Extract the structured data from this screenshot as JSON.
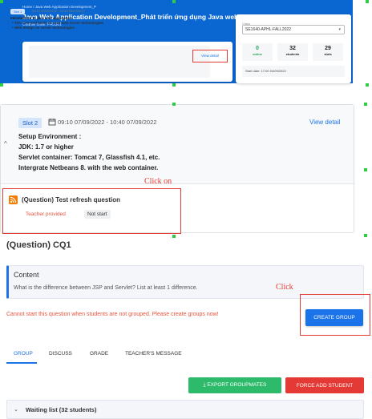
{
  "header": {
    "breadcrumb": "Home / Java Web Application Development_P",
    "course_title": "Java Web Application Development_Phát triển ứng dụng Java web",
    "course_code": "Course code: PRJ301"
  },
  "mini_slot": {
    "chip": "Slot 1",
    "time": "09:10 05/09/2022 - 10:40 05/09/2022",
    "lines": [
      "Introduction to java web application",
      "• The core and basic of Java web server technologies",
      "• Web design vs server technologies"
    ],
    "view_detail": "View detail"
  },
  "class_card": {
    "label": "Class",
    "selected": "SE1640-APHL-FALL2022",
    "stats": [
      {
        "value": "0",
        "label": "online"
      },
      {
        "value": "32",
        "label": "students"
      },
      {
        "value": "29",
        "label": "slots"
      }
    ],
    "start_date": "Start date: 17:00 04/09/2022"
  },
  "slot": {
    "chip": "Slot 2",
    "time": "09:10 07/09/2022 - 10:40 07/09/2022",
    "view_detail": "View detail",
    "lines": [
      "Setup Environment :",
      "JDK: 1.7 or higher",
      "Servlet container: Tomcat 7, Glassfish 4.1, etc.",
      "Intergrate Netbeans 8. with the web container."
    ]
  },
  "question_item": {
    "title": "(Question) Test refresh question",
    "provided": "Teacher provided",
    "status": "Not start"
  },
  "annotations": {
    "click_on": "Click on",
    "click": "Click"
  },
  "page": {
    "title": "(Question) CQ1",
    "content_heading": "Content",
    "content_text": "What is the difference between JSP and Servlet? List at least 1 difference.",
    "warning": "Cannot start this question when students are not grouped. Please create groups now!",
    "create_group": "CREATE GROUP"
  },
  "tabs": [
    "GROUP",
    "DISCUSS",
    "GRADE",
    "TEACHER'S MESSAGE"
  ],
  "actions": {
    "export": "EXPORT GROUPMATES",
    "force_add": "FORCE ADD STUDENT"
  },
  "waiting_list": "Waiting list (32 students)",
  "colors": {
    "primary": "#1a73e8",
    "header_blue": "#0a66d0",
    "danger": "#e53935",
    "success": "#2dba6a"
  }
}
